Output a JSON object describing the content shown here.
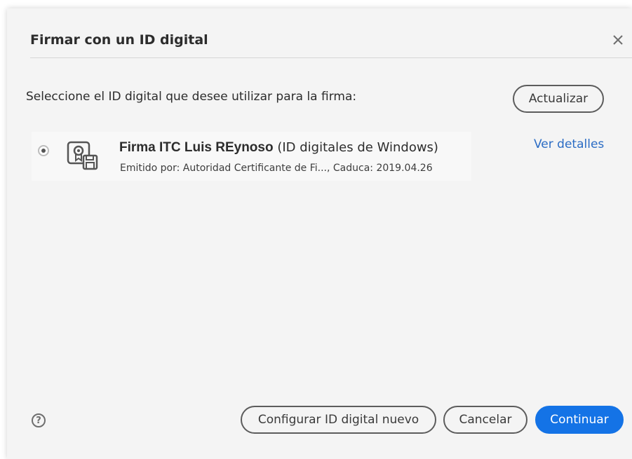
{
  "dialog": {
    "title": "Firmar con un ID digital",
    "instruction": "Seleccione el ID digital que desee utilizar para la firma:",
    "refresh_label": "Actualizar",
    "close_icon": "close-icon"
  },
  "digital_ids": [
    {
      "name": "Firma ITC Luis REynoso",
      "type": "(ID digitales de Windows)",
      "meta": "Emitido por: Autoridad Certificante de Fi..., Caduca: 2019.04.26",
      "selected": true,
      "icon": "certificate-icon"
    }
  ],
  "details_link": "Ver detalles",
  "footer": {
    "help_icon": "help-icon",
    "help_glyph": "?",
    "new_id_label": "Configurar ID digital nuevo",
    "cancel_label": "Cancelar",
    "continue_label": "Continuar"
  },
  "colors": {
    "primary": "#1473e6",
    "link": "#2b6cc4",
    "dialog_bg": "#f4f4f4"
  }
}
